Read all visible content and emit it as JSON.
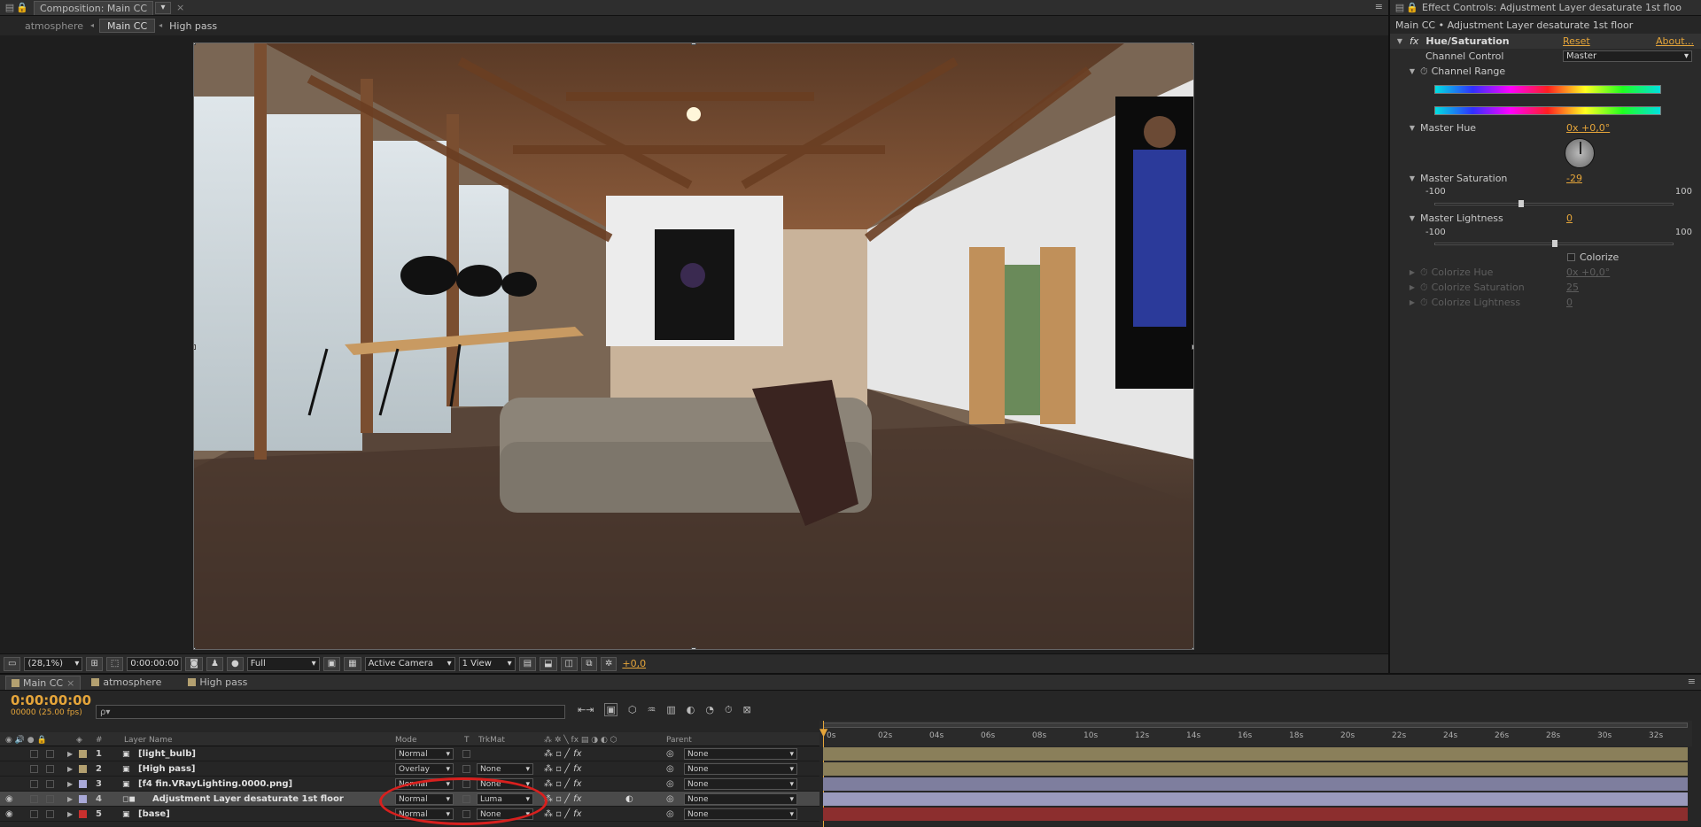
{
  "comp": {
    "tab_label": "Composition: Main CC",
    "breadcrumbs": [
      "atmosphere",
      "Main CC",
      "High pass"
    ],
    "toolbar": {
      "zoom": "(28,1%)",
      "timecode": "0:00:00:00",
      "resolution": "Full",
      "camera": "Active Camera",
      "view": "1 View",
      "exposure": "+0,0"
    }
  },
  "effect_controls": {
    "tab_label": "Effect Controls: Adjustment Layer desaturate 1st floo",
    "subtitle": "Main CC • Adjustment Layer desaturate 1st floor",
    "effect_name": "Hue/Saturation",
    "fx_badge": "fx",
    "reset_label": "Reset",
    "about_label": "About...",
    "channel_control_label": "Channel Control",
    "channel_control_value": "Master",
    "channel_range_label": "Channel Range",
    "master_hue_label": "Master Hue",
    "master_hue_value": "0x +0,0°",
    "master_hue_angle": 0,
    "master_saturation_label": "Master Saturation",
    "master_saturation_value": "-29",
    "saturation_min": "-100",
    "saturation_max": "100",
    "saturation_level": -29,
    "master_lightness_label": "Master Lightness",
    "master_lightness_value": "0",
    "lightness_min": "-100",
    "lightness_max": "100",
    "lightness_level": 0,
    "colorize_label": "Colorize",
    "colorize_hue_label": "Colorize Hue",
    "colorize_hue_value": "0x +0,0°",
    "colorize_saturation_label": "Colorize Saturation",
    "colorize_saturation_value": "25",
    "colorize_lightness_label": "Colorize Lightness",
    "colorize_lightness_value": "0"
  },
  "timeline": {
    "tabs": [
      "Main CC",
      "atmosphere",
      "High pass"
    ],
    "timecode": "0:00:00:00",
    "frame_info": "00000 (25.00 fps)",
    "search_placeholder": "ρ▾",
    "headers": {
      "num": "#",
      "layer_name": "Layer Name",
      "mode": "Mode",
      "t": "T",
      "trkmat": "TrkMat",
      "parent": "Parent"
    },
    "ruler_labels": [
      "0s",
      "02s",
      "04s",
      "06s",
      "08s",
      "10s",
      "12s",
      "14s",
      "16s",
      "18s",
      "20s",
      "22s",
      "24s",
      "26s",
      "28s",
      "30s",
      "32s"
    ],
    "layers": [
      {
        "num": "1",
        "name": "[light_bulb]",
        "mode": "Normal",
        "trkmat": "",
        "parent": "None",
        "label_color": "#b3a070",
        "bar_color": "#8a7f5a",
        "visible": false
      },
      {
        "num": "2",
        "name": "[High pass]",
        "mode": "Overlay",
        "trkmat": "None",
        "parent": "None",
        "label_color": "#b3a070",
        "bar_color": "#8a7f5a",
        "visible": false
      },
      {
        "num": "3",
        "name": "[f4 fin.VRayLighting.0000.png]",
        "mode": "Normal",
        "trkmat": "None",
        "parent": "None",
        "label_color": "#a9a9d8",
        "bar_color": "#7e7e9e",
        "visible": false
      },
      {
        "num": "4",
        "name": "Adjustment Layer desaturate 1st floor",
        "mode": "Normal",
        "trkmat": "Luma",
        "parent": "None",
        "label_color": "#a9a9d8",
        "bar_color": "#9a9abd",
        "visible": true
      },
      {
        "num": "5",
        "name": "[base]",
        "mode": "Normal",
        "trkmat": "None",
        "parent": "None",
        "label_color": "#c8302e",
        "bar_color": "#8c2e2e",
        "visible": true
      }
    ]
  }
}
